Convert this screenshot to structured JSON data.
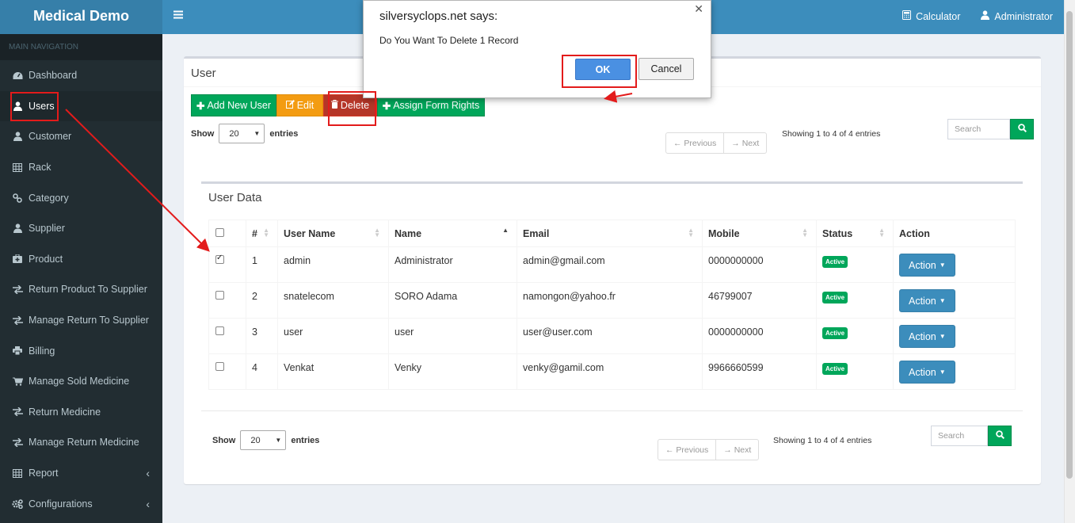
{
  "brand": "Medical Demo",
  "nav_header": "MAIN NAVIGATION",
  "nav": [
    {
      "label": "Dashboard",
      "icon": "dashboard-icon"
    },
    {
      "label": "Users",
      "icon": "user-icon"
    },
    {
      "label": "Customer",
      "icon": "user-icon"
    },
    {
      "label": "Rack",
      "icon": "table-icon"
    },
    {
      "label": "Category",
      "icon": "link-icon"
    },
    {
      "label": "Supplier",
      "icon": "user-icon"
    },
    {
      "label": "Product",
      "icon": "medkit-icon"
    },
    {
      "label": "Return Product To Supplier",
      "icon": "exchange-icon"
    },
    {
      "label": "Manage Return To Supplier",
      "icon": "exchange-icon"
    },
    {
      "label": "Billing",
      "icon": "print-icon"
    },
    {
      "label": "Manage Sold Medicine",
      "icon": "cart-icon"
    },
    {
      "label": "Return Medicine",
      "icon": "exchange-icon"
    },
    {
      "label": "Manage Return Medicine",
      "icon": "exchange-icon"
    },
    {
      "label": "Report",
      "icon": "table-icon"
    },
    {
      "label": "Configurations",
      "icon": "cogs-icon"
    }
  ],
  "topbar": {
    "calculator": "Calculator",
    "user": "Administrator"
  },
  "page": {
    "title": "User",
    "buttons": {
      "add": "Add New User",
      "edit": "Edit",
      "delete": "Delete",
      "assign": "Assign Form Rights"
    },
    "show_label": "Show",
    "entries_label": "entries",
    "page_size": "20",
    "previous": "← Previous",
    "next": "→ Next",
    "showing": "Showing 1 to 4 of 4 entries",
    "search_placeholder": "Search"
  },
  "table": {
    "title": "User Data",
    "columns": [
      "#",
      "User Name",
      "Name",
      "Email",
      "Mobile",
      "Status",
      "Action"
    ],
    "rows": [
      {
        "num": "1",
        "username": "admin",
        "name": "Administrator",
        "email": "admin@gmail.com",
        "mobile": "0000000000",
        "status": "Active",
        "action": "Action",
        "checked": true
      },
      {
        "num": "2",
        "username": "snatelecom",
        "name": "SORO Adama",
        "email": "namongon@yahoo.fr",
        "mobile": "46799007",
        "status": "Active",
        "action": "Action",
        "checked": false
      },
      {
        "num": "3",
        "username": "user",
        "name": "user",
        "email": "user@user.com",
        "mobile": "0000000000",
        "status": "Active",
        "action": "Action",
        "checked": false
      },
      {
        "num": "4",
        "username": "Venkat",
        "name": "Venky",
        "email": "venky@gamil.com",
        "mobile": "9966660599",
        "status": "Active",
        "action": "Action",
        "checked": false
      }
    ]
  },
  "dialog": {
    "title": "silversyclops.net says:",
    "message": "Do You Want To Delete 1 Record",
    "ok": "OK",
    "cancel": "Cancel"
  },
  "colors": {
    "sidebar": "#222d32",
    "topbar": "#3c8dbc",
    "highlight": "#e31b1b"
  }
}
